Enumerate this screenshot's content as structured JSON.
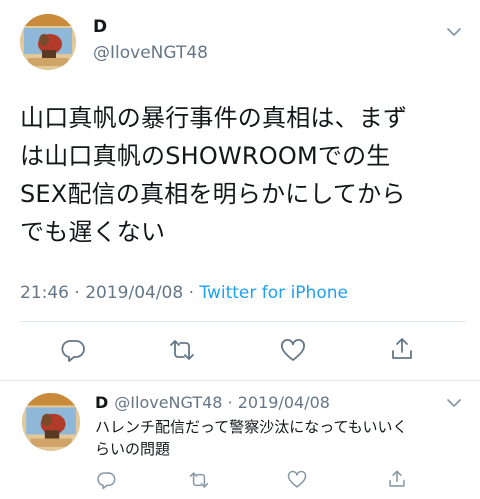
{
  "tweet": {
    "display_name": "D",
    "handle": "@IloveNGT48",
    "lines": [
      "山口真帆の暴行事件の真相は、まず",
      "は山口真帆のSHOWROOMでの生",
      "SEX配信の真相を明らかにしてから",
      "でも遅くない"
    ],
    "time": "21:46 · 2019/04/08 · ",
    "source": "Twitter for iPhone"
  },
  "reply": {
    "display_name": "D",
    "handle_date": "@IloveNGT48 · 2019/04/08",
    "lines": [
      "ハレンチ配信だって警察沙汰になってもいいく",
      "らいの問題"
    ]
  },
  "icons": {
    "main_actions": [
      "reply-icon",
      "retweet-icon",
      "like-icon",
      "share-icon"
    ],
    "reply_actions": [
      "reply-icon",
      "retweet-icon",
      "like-icon",
      "share-icon"
    ],
    "menu": "chevron-down-icon",
    "avatar": "avatar-character-image"
  },
  "colors": {
    "text": "#14171a",
    "secondary": "#657786",
    "link": "#1da1f2",
    "divider": "#e1e8ed"
  }
}
